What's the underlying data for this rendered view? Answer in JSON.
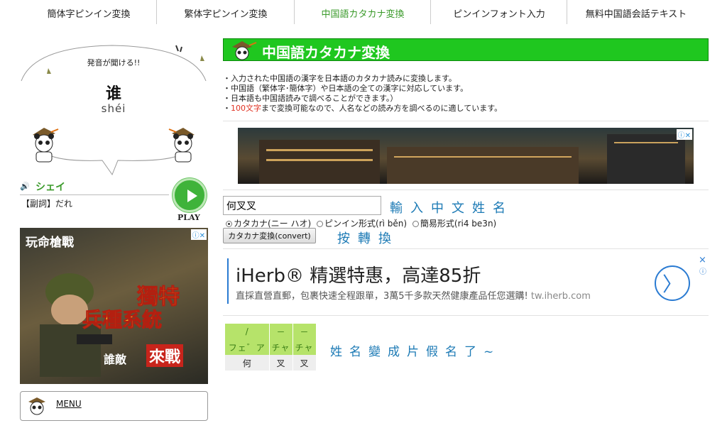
{
  "nav": {
    "items": [
      {
        "label": "簡体字ピンイン変換",
        "active": false
      },
      {
        "label": "繁体字ピンイン変換",
        "active": false
      },
      {
        "label": "中国語カタカナ変換",
        "active": true
      },
      {
        "label": "ピンインフォント入力",
        "active": false
      },
      {
        "label": "無料中国語会話テキスト",
        "active": false
      }
    ]
  },
  "widget": {
    "caption": "発音が聞ける!!",
    "hanzi": "谁",
    "pinyin": "shéi",
    "katakana": "シェイ",
    "definition": "【副詞】だれ",
    "play_label": "PLAY"
  },
  "left_ad": {
    "logo": "玩命槍戰",
    "line1": "獨特",
    "line2": "兵種系統",
    "line3": "誰敵",
    "line4": "來戰"
  },
  "menu": {
    "label": "MENU"
  },
  "main": {
    "title": "中国語カタカナ変換",
    "desc": [
      "・入力された中国語の漢字を日本語のカタカナ読みに変換します。",
      "・中国語（繁体字･簡体字）や日本語の全ての漢字に対応しています。",
      "・日本語も中国語読みで調べることができます。）"
    ],
    "desc_last_red": "100文字",
    "desc_last_rest": "まで変換可能なので、人名などの読み方を調べるのに適しています。",
    "input_value": "何叉叉",
    "handwriting_1": "輸入中文姓名",
    "radio_options": [
      {
        "label": "カタカナ(ニー ハオ)",
        "selected": true
      },
      {
        "label": "ピンイン形式(rì běn)",
        "selected": false
      },
      {
        "label": "簡易形式(ri4 be3n)",
        "selected": false
      }
    ],
    "convert_label": "カタカナ変換(convert)",
    "handwriting_2": "按轉換"
  },
  "ad_iherb": {
    "title": "iHerb® 精選特惠，高達85折",
    "subtitle": "直採直營直郵，包裹快速全程跟單，3萬5千多款天然健康產品任您選購!",
    "url": "tw.iherb.com",
    "arrow": "〉",
    "close": "×",
    "info": "ⓘ"
  },
  "result": {
    "row1": [
      "/",
      "－",
      "－"
    ],
    "row2": [
      "フェ゛ア",
      "チャ",
      "チャ"
    ],
    "row3": [
      "何",
      "叉",
      "叉"
    ]
  },
  "handwriting_3": "姓名變成片假名了~"
}
